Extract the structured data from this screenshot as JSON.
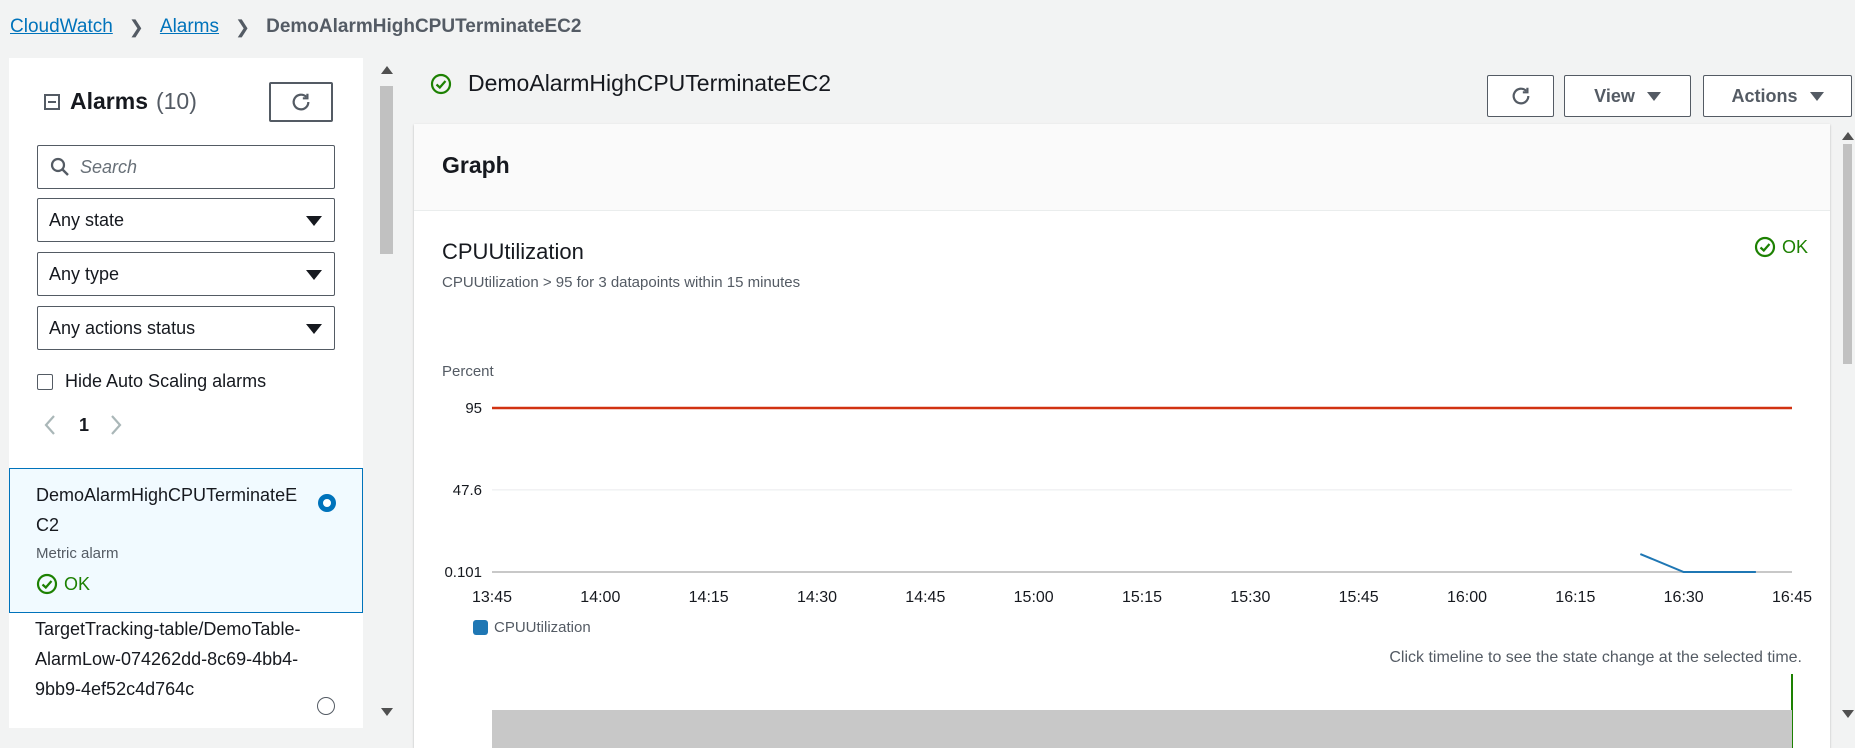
{
  "breadcrumb": {
    "root": "CloudWatch",
    "section": "Alarms",
    "current": "DemoAlarmHighCPUTerminateEC2"
  },
  "sidebar": {
    "title": "Alarms",
    "count": "(10)",
    "search_placeholder": "Search",
    "filters": [
      "Any state",
      "Any type",
      "Any actions status"
    ],
    "hide_autoscaling_label": "Hide Auto Scaling alarms",
    "page": "1",
    "alarms": [
      {
        "name": "DemoAlarmHighCPUTerminateEC2",
        "type": "Metric alarm",
        "state": "OK",
        "selected": true
      },
      {
        "name": "TargetTracking-table/DemoTable-AlarmLow-074262dd-8c69-4bb4-9bb9-4ef52c4d764c",
        "selected": false
      }
    ]
  },
  "main": {
    "alarm_title": "DemoAlarmHighCPUTerminateEC2",
    "buttons": {
      "view": "View",
      "actions": "Actions"
    },
    "panel_title": "Graph",
    "metric_title": "CPUUtilization",
    "condition": "CPUUtilization > 95 for 3 datapoints within 15 minutes",
    "state": "OK",
    "timeline_hint": "Click timeline to see the state change at the selected time."
  },
  "chart_data": {
    "type": "line",
    "ylabel": "Percent",
    "yticks": [
      "95",
      "47.6",
      "0.101"
    ],
    "ylim": [
      0.101,
      95
    ],
    "xticks": [
      "13:45",
      "14:00",
      "14:15",
      "14:30",
      "14:45",
      "15:00",
      "15:15",
      "15:30",
      "15:45",
      "16:00",
      "16:15",
      "16:30",
      "16:45"
    ],
    "threshold": {
      "value": 95,
      "color": "#d13212"
    },
    "series": [
      {
        "name": "CPUUtilization",
        "color": "#1f77b4",
        "points": [
          [
            "16:24",
            10.5
          ],
          [
            "16:30",
            0.101
          ],
          [
            "16:35",
            0.101
          ],
          [
            "16:40",
            0.101
          ]
        ]
      }
    ],
    "grid": true,
    "legend": "bottom-left"
  },
  "colors": {
    "link": "#0073bb",
    "ok": "#1d8102",
    "threshold": "#d13212",
    "series": "#1f77b4"
  }
}
